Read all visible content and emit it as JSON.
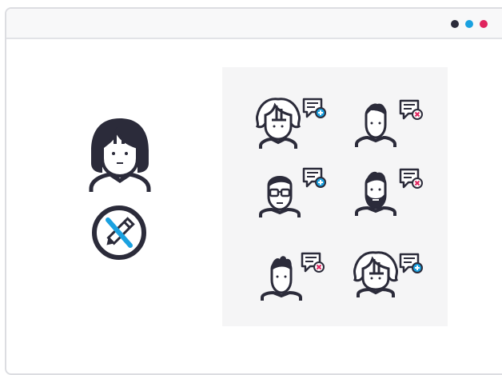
{
  "colors": {
    "ink": "#2b2b3a",
    "accent_blue": "#1aa1e0",
    "accent_red": "#e0245e",
    "dot_dark": "#2b2b3a",
    "dot_blue": "#1aa1e0",
    "dot_red": "#e0245e",
    "panel_bg": "#f5f5f6"
  },
  "window_controls": [
    "dot-dark",
    "dot-blue",
    "dot-red"
  ],
  "profile": {
    "avatar_icon": "woman-avatar-icon",
    "edit_icon": "pencil-edit-icon"
  },
  "users": [
    {
      "avatar": "curly-hair-avatar",
      "badge": "comment-add-icon"
    },
    {
      "avatar": "short-hair-avatar",
      "badge": "comment-remove-icon"
    },
    {
      "avatar": "glasses-avatar",
      "badge": "comment-add-icon"
    },
    {
      "avatar": "bearded-avatar",
      "badge": "comment-remove-icon"
    },
    {
      "avatar": "spiky-hair-avatar",
      "badge": "comment-remove-icon"
    },
    {
      "avatar": "curly-hair-avatar",
      "badge": "comment-add-icon"
    }
  ]
}
